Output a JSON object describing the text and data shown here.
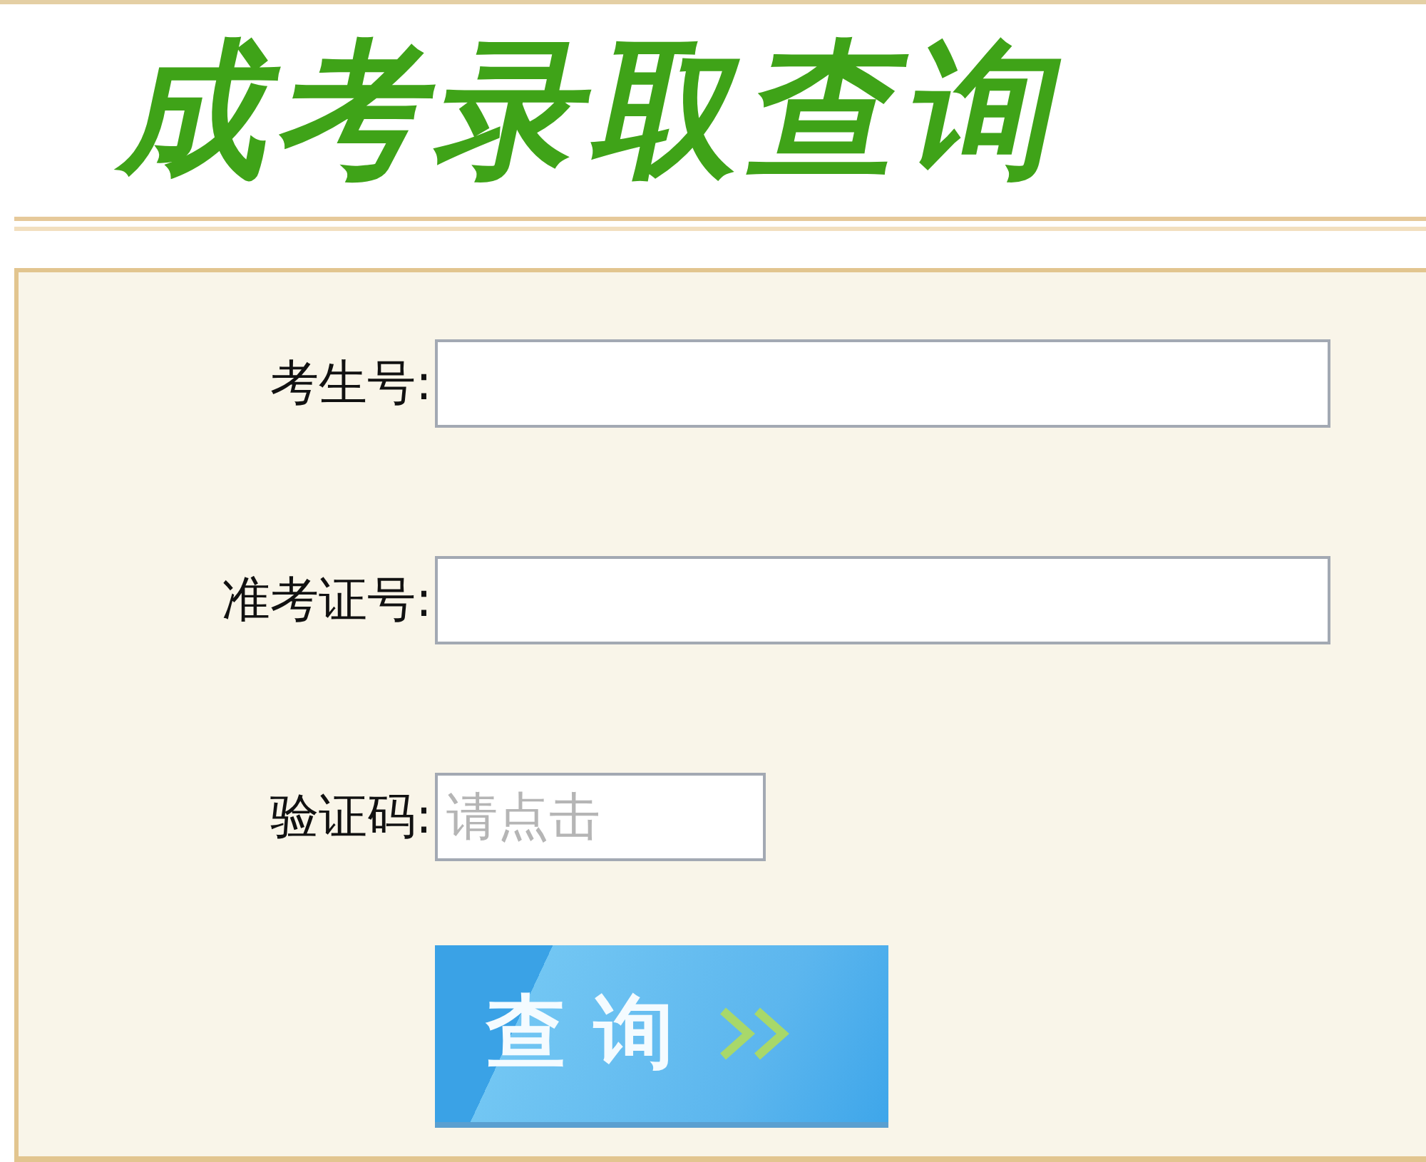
{
  "header": {
    "title": "成考录取查询"
  },
  "form": {
    "fields": [
      {
        "label": "考生号:",
        "kind": "text"
      },
      {
        "label": "准考证号:",
        "kind": "text"
      },
      {
        "label": "验证码:",
        "kind": "captcha",
        "placeholder": "请点击"
      }
    ],
    "submit": {
      "label": "查 询"
    }
  }
}
